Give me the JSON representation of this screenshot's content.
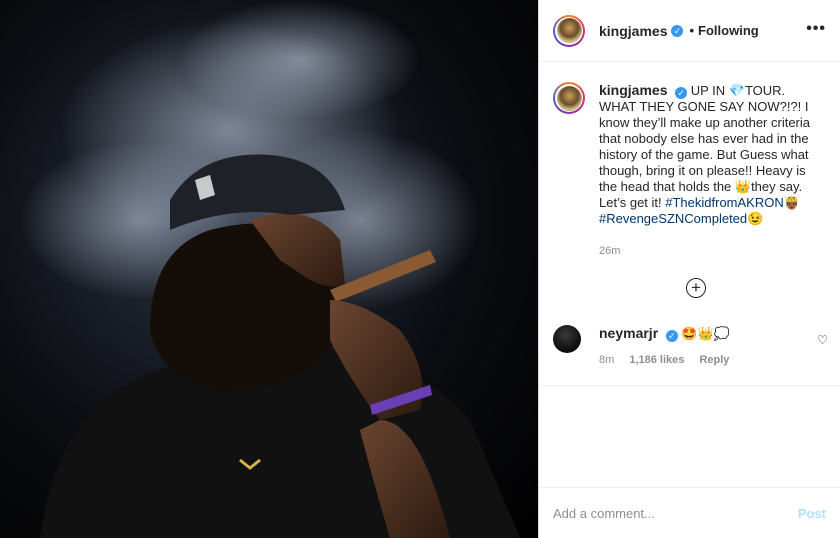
{
  "post": {
    "header": {
      "username": "kingjames",
      "verified_mark": "✓",
      "separator": "•",
      "follow_status": "Following",
      "more_icon": "•••"
    },
    "caption": {
      "username": "kingjames",
      "text_part1": "UP IN 💎TOUR. WHAT THEY GONE SAY NOW?!?! I know they’ll make up another criteria that nobody else has ever had in the history of the game. But Guess what though, bring it on please!! Heavy is the head that holds the 👑they say. Let’s get it! ",
      "hashtag1": "#ThekidfromAKRON",
      "emoji1": "🤴🏾",
      "hashtag2": "#RevengeSZNCompleted",
      "emoji2": "😉",
      "time": "26m"
    },
    "load_more_icon": "+",
    "comments": [
      {
        "username": "neymarjr",
        "text": "🤩👑💭",
        "time": "8m",
        "likes": "1,186 likes",
        "reply_label": "Reply"
      }
    ],
    "heart_icon": "♡",
    "input": {
      "placeholder": "Add a comment...",
      "post_label": "Post"
    }
  },
  "colors": {
    "accent": "#3897f0",
    "post_disabled": "#b2dffc",
    "hashtag": "#003569",
    "muted": "#8e8e8e"
  }
}
